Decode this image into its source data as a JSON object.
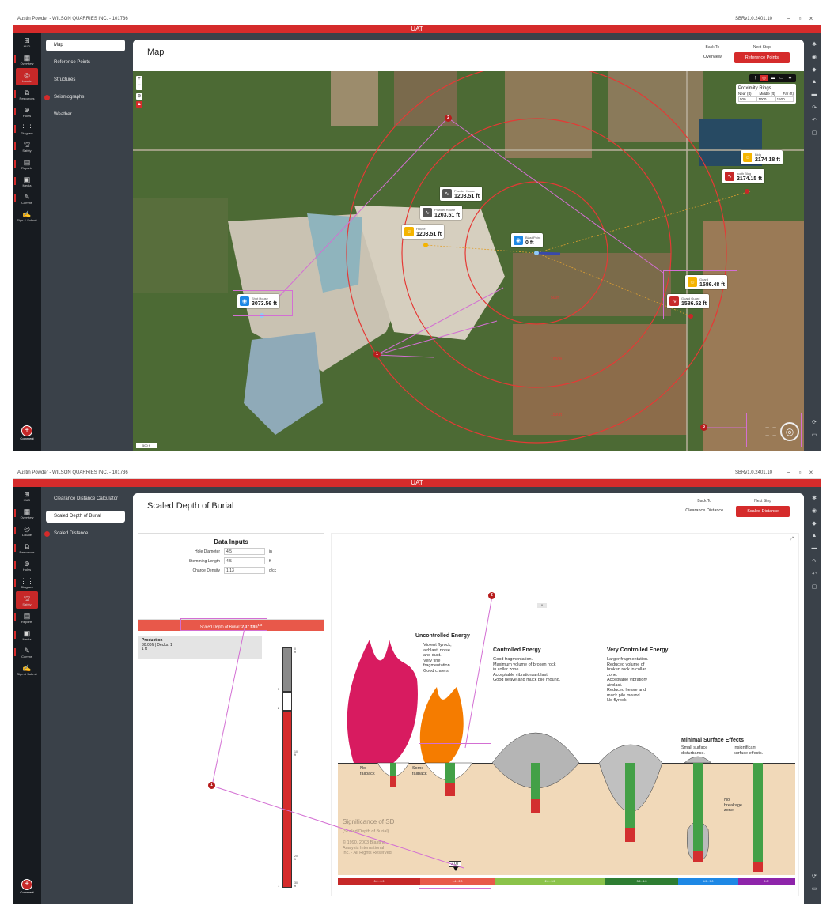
{
  "window1": {
    "title": "Austin Powder - WILSON QUARRIES INC. - 101736",
    "version": "SBRv1.0.2401.10",
    "env": "UAT",
    "rail": [
      {
        "label": "HUD",
        "glyph": "⊞"
      },
      {
        "label": "Overview",
        "glyph": "▦"
      },
      {
        "label": "Locate",
        "glyph": "◎",
        "active": true
      },
      {
        "label": "Resources",
        "glyph": "⧉"
      },
      {
        "label": "Holes",
        "glyph": "⊕"
      },
      {
        "label": "Diagram",
        "glyph": "⋮⋮"
      },
      {
        "label": "Safety",
        "glyph": "⛫"
      },
      {
        "label": "Reports",
        "glyph": "▤"
      },
      {
        "label": "Media",
        "glyph": "▣"
      },
      {
        "label": "Comms",
        "glyph": "✎"
      },
      {
        "label": "Sign & Submit",
        "glyph": "✍"
      }
    ],
    "comment": "Comment",
    "subnav": [
      {
        "label": "Map",
        "selected": true
      },
      {
        "label": "Reference Points"
      },
      {
        "label": "Structures"
      },
      {
        "label": "Seismographs",
        "dot": true
      },
      {
        "label": "Weather"
      }
    ],
    "page_title": "Map",
    "back_to_label": "Back To",
    "back_to_btn": "Overview",
    "next_step_label": "Next Step",
    "next_step_btn": "Reference Points",
    "zoom_in": "+",
    "zoom_out": "−",
    "proximity": {
      "title": "Proximity Rings",
      "near_label": "Near (ft)",
      "middle_label": "Middle (ft)",
      "far_label": "Far (ft)",
      "near": "500",
      "middle": "1000",
      "far": "1500"
    },
    "rings": [
      {
        "label": "500ft"
      },
      {
        "label": "1000ft"
      },
      {
        "label": "1500ft"
      }
    ],
    "markers": [
      {
        "name": "Powder House",
        "dist": "1203.51 ft",
        "icon": "gray"
      },
      {
        "name": "Powder House",
        "dist": "1203.51 ft",
        "icon": "gray"
      },
      {
        "name": "House",
        "dist": "1203.51 ft",
        "icon": "yellow"
      },
      {
        "name": "Blast Point",
        "dist": "0 ft",
        "icon": "blue"
      },
      {
        "name": "Shot House",
        "dist": "3073.56 ft",
        "icon": "blue"
      },
      {
        "name": "Guard",
        "dist": "1586.48 ft",
        "icon": "yellow"
      },
      {
        "name": "Guard Guard",
        "dist": "1586.52 ft",
        "icon": "red"
      },
      {
        "name": "Bldg",
        "dist": "2174.18 ft",
        "icon": "yellow"
      },
      {
        "name": "north Bldg",
        "dist": "2174.15 ft",
        "icon": "red"
      }
    ],
    "annotations": [
      "1",
      "2",
      "3"
    ],
    "scale_label": "500 ft"
  },
  "window2": {
    "subnav": [
      {
        "label": "Clearance Distance Calculator"
      },
      {
        "label": "Scaled Depth of Burial",
        "selected": true
      },
      {
        "label": "Scaled Distance",
        "dot": true
      }
    ],
    "page_title": "Scaled Depth of Burial",
    "back_to_label": "Back To",
    "back_to_btn": "Clearance Distance",
    "next_step_label": "Next Step",
    "next_step_btn": "Scaled Distance",
    "inputs_title": "Data Inputs",
    "inputs": [
      {
        "label": "Hole Diameter",
        "value": "4.5",
        "unit": "in"
      },
      {
        "label": "Stemming Length",
        "value": "4.5",
        "unit": "ft"
      },
      {
        "label": "Charge Density",
        "value": "1.13",
        "unit": "g/cc"
      }
    ],
    "sdob_label": "Scaled Depth of Burial:",
    "sdob_value": "2.07 ft/lb",
    "sdob_exp": "1/3",
    "production_title": "Production",
    "production_sub": "30.00ft | Decks: 1",
    "production_sub2": "1 ft",
    "column_depths": [
      "0 ft",
      "10 ft",
      "20 ft",
      "30 ft"
    ],
    "column_marks": [
      "3",
      "2",
      "1"
    ],
    "energy": [
      {
        "title": "Uncontrolled Energy",
        "lines": [
          "Violent flyrock,",
          "airblast, noise",
          "and dust.",
          "Very fine",
          "fragmentation.",
          "Good craters."
        ]
      },
      {
        "title": "Controlled Energy",
        "lines": [
          "Good fragmentation.",
          "Maximum volume of broken rock",
          "in collar zone.",
          "Acceptable vibration/airblast.",
          "Good heave and muck pile mound."
        ]
      },
      {
        "title": "Very Controlled Energy",
        "lines": [
          "Larger fragmentation.",
          "Reduced volume of",
          "broken rock in collar",
          "zone.",
          "Acceptable vibration/",
          "airblast.",
          "Reduced heave and",
          "muck pile mound.",
          "No flyrock."
        ]
      },
      {
        "title": "Minimal Surface Effects",
        "lines": [
          "Small surface",
          "disturbance."
        ]
      }
    ],
    "insignificant": [
      "Insignificant",
      "surface effects."
    ],
    "no_fallback": [
      "No",
      "fallback"
    ],
    "some_fallback": [
      "Some",
      "fallback"
    ],
    "no_breakage": [
      "No",
      "breakage",
      "zone"
    ],
    "significance": "Significance of SD",
    "significance_sub": "(Scaled Depth of Burial)",
    "copyright": [
      "© 1990, 2003 Blasting",
      "Analysis International",
      "Inc. - All Rights Reserved"
    ],
    "indicator_value": "2.07",
    "scale_segments": [
      {
        "label": "0.0 - 0.9",
        "color": "#c62828"
      },
      {
        "label": "1.4 - 2.0",
        "color": "#e8584a"
      },
      {
        "label": "2.0 - 3.5",
        "color": "#8bc34a"
      },
      {
        "label": "3.5 - 4.5",
        "color": "#2e7d32"
      },
      {
        "label": "4.5 - 9.0",
        "color": "#1e88e5"
      },
      {
        "label": "9.0+",
        "color": "#8e24aa"
      }
    ],
    "annotations": [
      "1",
      "2"
    ]
  }
}
